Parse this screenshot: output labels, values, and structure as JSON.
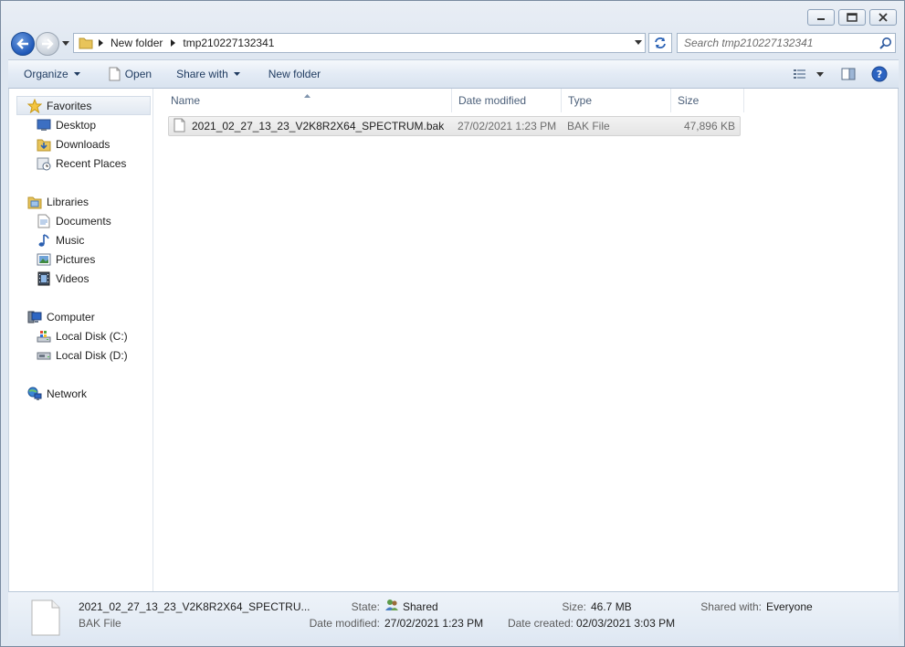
{
  "window": {
    "minimize": "minimize",
    "maximize": "maximize",
    "close": "close"
  },
  "address": {
    "breadcrumbs": [
      "New folder",
      "tmp210227132341"
    ]
  },
  "search": {
    "placeholder": "Search tmp210227132341"
  },
  "toolbar": {
    "organize": "Organize",
    "open": "Open",
    "share_with": "Share with",
    "new_folder": "New folder"
  },
  "sidebar": {
    "favorites": {
      "label": "Favorites",
      "items": [
        "Desktop",
        "Downloads",
        "Recent Places"
      ]
    },
    "libraries": {
      "label": "Libraries",
      "items": [
        "Documents",
        "Music",
        "Pictures",
        "Videos"
      ]
    },
    "computer": {
      "label": "Computer",
      "items": [
        "Local Disk (C:)",
        "Local Disk (D:)"
      ]
    },
    "network": {
      "label": "Network"
    }
  },
  "columns": {
    "name": "Name",
    "date": "Date modified",
    "type": "Type",
    "size": "Size"
  },
  "files": [
    {
      "name": "2021_02_27_13_23_V2K8R2X64_SPECTRUM.bak",
      "date": "27/02/2021 1:23 PM",
      "type": "BAK File",
      "size": "47,896 KB"
    }
  ],
  "details": {
    "name": "2021_02_27_13_23_V2K8R2X64_SPECTRU...",
    "type": "BAK File",
    "state_label": "State:",
    "state_value": "Shared",
    "date_modified_label": "Date modified:",
    "date_modified_value": "27/02/2021 1:23 PM",
    "size_label": "Size:",
    "size_value": "46.7 MB",
    "date_created_label": "Date created:",
    "date_created_value": "02/03/2021 3:03 PM",
    "shared_with_label": "Shared with:",
    "shared_with_value": "Everyone"
  },
  "colors": {
    "accent": "#1e3a5f",
    "selection": "#e5e5e5"
  }
}
